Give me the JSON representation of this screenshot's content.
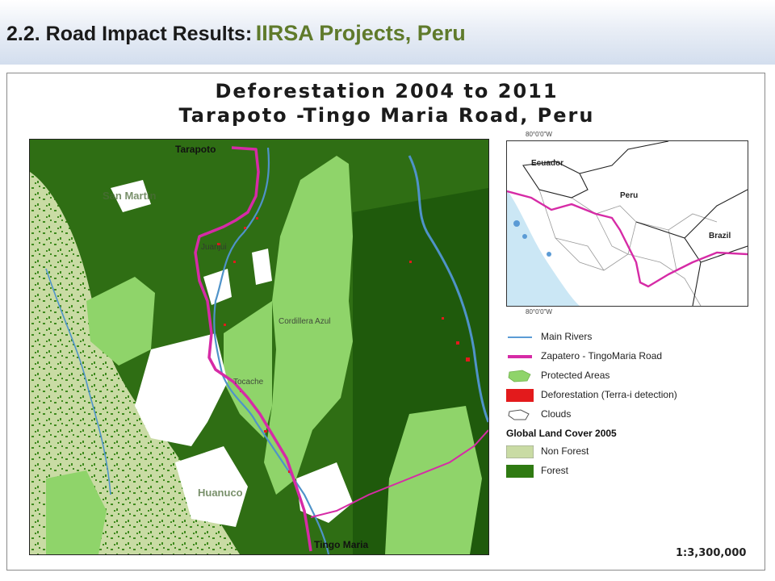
{
  "slide": {
    "title_prefix": "2.2.  Road Impact Results:",
    "title_accent": "IIRSA Projects, Peru"
  },
  "map": {
    "title_line1": "Deforestation 2004 to 2011",
    "title_line2": "Tarapoto -Tingo Maria Road, Peru",
    "places": {
      "tarapoto": "Tarapoto",
      "san_martin": "San Martin",
      "juanjui": "Juanjui",
      "tocache": "Tocache",
      "cordillera_azul": "Cordillera Azul",
      "huanuco": "Huanuco",
      "tingo_maria": "Tingo Maria"
    },
    "scale": "1:3,300,000"
  },
  "inset": {
    "countries": {
      "ecuador": "Ecuador",
      "peru": "Peru",
      "brazil": "Brazil"
    },
    "coord_top": "80°0'0\"W",
    "coord_bottom": "80°0'0\"W"
  },
  "legend": {
    "items": [
      {
        "label": "Main Rivers",
        "color": "#5b9bd5"
      },
      {
        "label": "Zapatero - TingoMaria Road",
        "color": "#d62ba6"
      },
      {
        "label": "Protected Areas",
        "color": "#8fd46a"
      },
      {
        "label": "Deforestation (Terra-i detection)",
        "color": "#e31a1c"
      },
      {
        "label": "Clouds",
        "color": "#ffffff"
      }
    ],
    "land_cover_heading": "Global Land Cover 2005",
    "land_cover": [
      {
        "label": "Non Forest",
        "color": "#c9dba4"
      },
      {
        "label": "Forest",
        "color": "#2f7a12"
      }
    ]
  }
}
